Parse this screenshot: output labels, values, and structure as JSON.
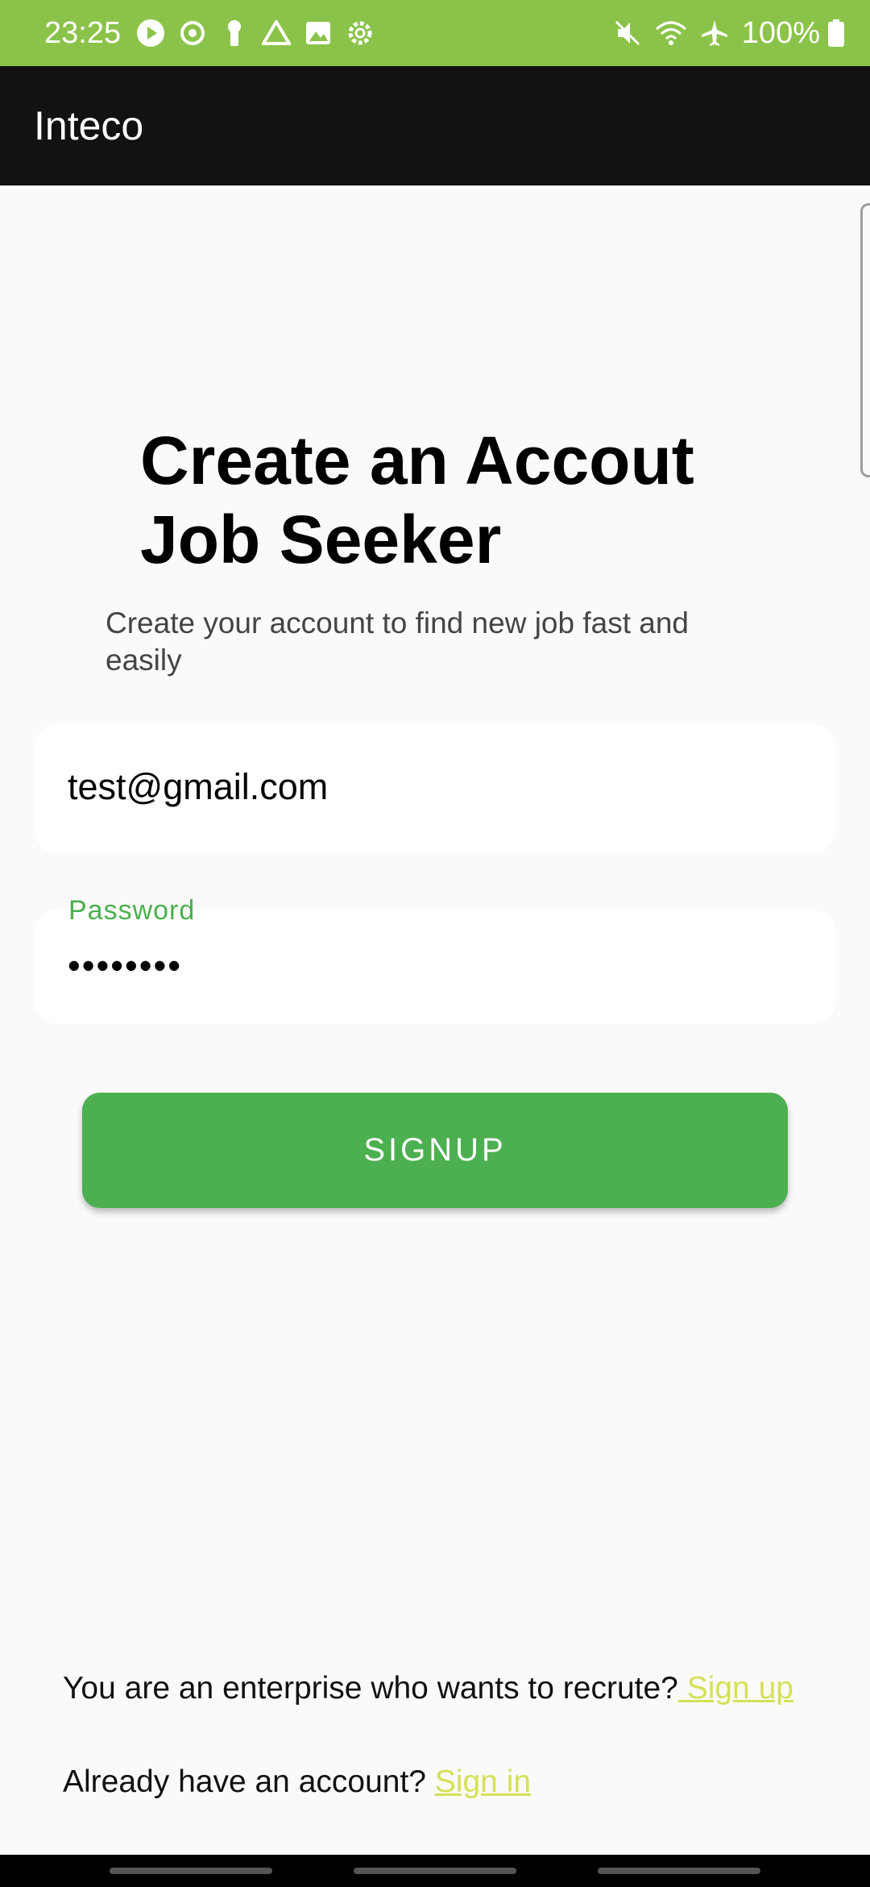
{
  "status_bar": {
    "time": "23:25",
    "battery": "100%",
    "left_icons": [
      "play-icon",
      "sync-icon",
      "keyhole-icon",
      "drive-icon",
      "image-icon",
      "settings-icon"
    ],
    "right_icons": [
      "mute-icon",
      "wifi-icon",
      "airplane-icon",
      "battery-icon"
    ],
    "color": "#8bc34a"
  },
  "app_bar": {
    "title": "Inteco",
    "color": "#121212"
  },
  "main": {
    "title_line1": "Create an Accout",
    "title_line2": "Job Seeker",
    "subtitle": "Create your account to find new job fast and easily",
    "email_value": "test@gmail.com",
    "password_label": "Password",
    "password_value": "••••••••",
    "signup_label": "SIGNUP"
  },
  "footer": {
    "enterprise_text": "You are an enterprise who wants to recrute?",
    "enterprise_link": " Sign up",
    "account_text": "Already have an account? ",
    "account_link": "Sign in"
  },
  "colors": {
    "accent": "#4caf50",
    "link": "#d4e157"
  }
}
